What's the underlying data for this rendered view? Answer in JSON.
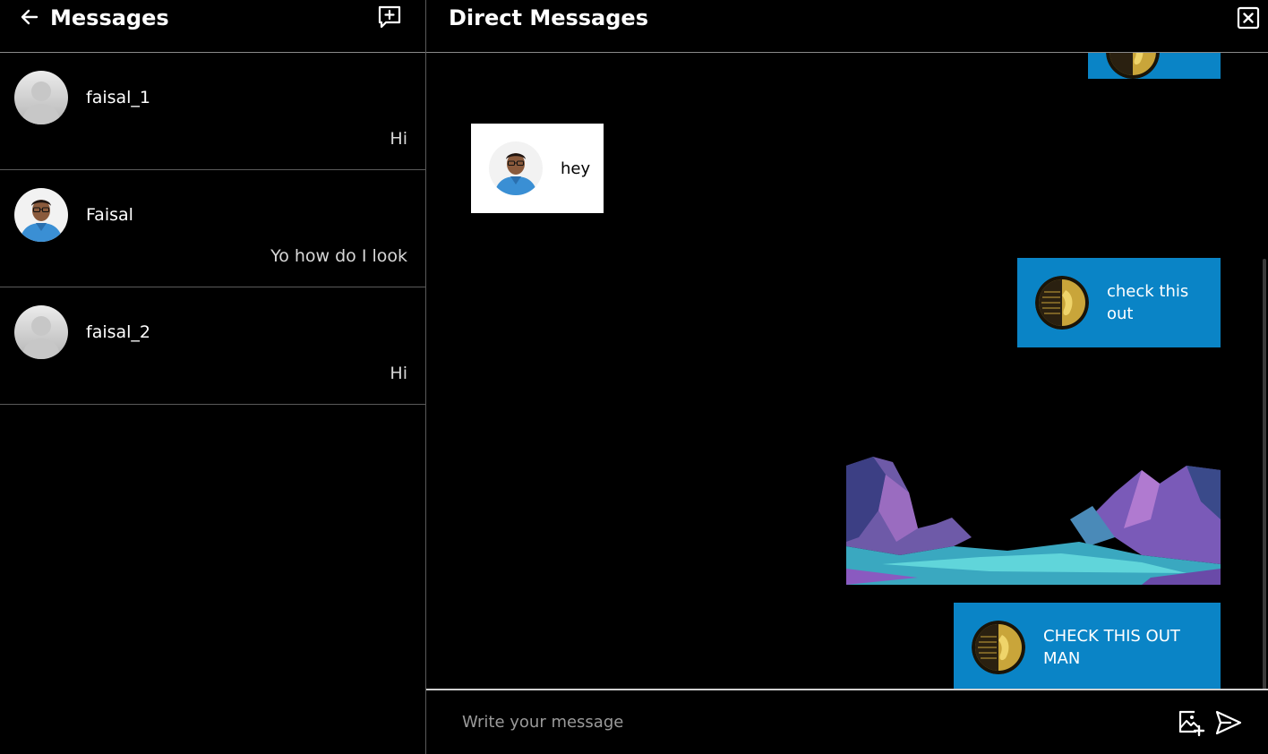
{
  "left_panel": {
    "title": "Messages",
    "back_icon": "arrow-left-icon",
    "new_chat_icon": "new-message-icon",
    "conversations": [
      {
        "name": "faisal_1",
        "preview": "Hi",
        "avatar": "default-avatar"
      },
      {
        "name": "Faisal",
        "preview": "Yo how do I look",
        "avatar": "user-photo"
      },
      {
        "name": "faisal_2",
        "preview": "Hi",
        "avatar": "default-avatar"
      }
    ]
  },
  "right_panel": {
    "title": "Direct Messages",
    "close_icon": "close-box-icon",
    "messages": [
      {
        "type": "sent",
        "text": ""
      },
      {
        "type": "received",
        "text": "hey"
      },
      {
        "type": "sent",
        "text": "check this out"
      },
      {
        "type": "sent-image"
      },
      {
        "type": "sent",
        "text": "CHECK THIS OUT MAN"
      }
    ]
  },
  "composer": {
    "placeholder": "Write your message",
    "value": "",
    "add_image_icon": "add-image-icon",
    "send_icon": "send-icon"
  },
  "colors": {
    "background": "#000000",
    "sent_bubble": "#0a84c6",
    "received_bubble": "#ffffff",
    "divider": "#5a5a5a"
  }
}
